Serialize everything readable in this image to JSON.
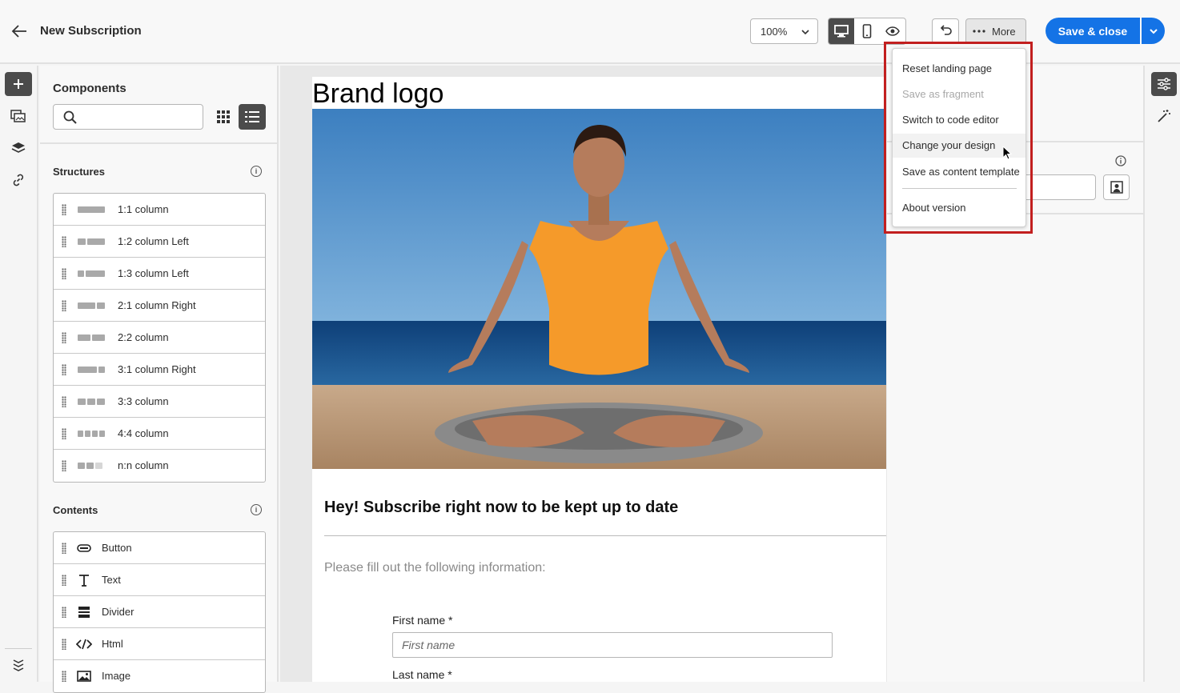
{
  "header": {
    "title": "New Subscription",
    "zoom_value": "100%",
    "more_label": "More",
    "save_label": "Save & close"
  },
  "components_panel": {
    "title": "Components",
    "search_placeholder": "",
    "structures_title": "Structures",
    "structures": [
      {
        "label": "1:1 column",
        "icon": "one-one-column"
      },
      {
        "label": "1:2 column Left",
        "icon": "one-two-column-left"
      },
      {
        "label": "1:3 column Left",
        "icon": "one-three-column-left"
      },
      {
        "label": "2:1 column Right",
        "icon": "two-one-column-right"
      },
      {
        "label": "2:2 column",
        "icon": "two-two-column"
      },
      {
        "label": "3:1 column Right",
        "icon": "three-one-column-right"
      },
      {
        "label": "3:3 column",
        "icon": "three-three-column"
      },
      {
        "label": "4:4 column",
        "icon": "four-four-column"
      },
      {
        "label": "n:n column",
        "icon": "n-n-column"
      }
    ],
    "contents_title": "Contents",
    "contents": [
      {
        "label": "Button",
        "icon": "button-icon"
      },
      {
        "label": "Text",
        "icon": "text-icon"
      },
      {
        "label": "Divider",
        "icon": "divider-icon"
      },
      {
        "label": "Html",
        "icon": "code-icon"
      },
      {
        "label": "Image",
        "icon": "image-icon"
      }
    ]
  },
  "canvas": {
    "brand_logo": "Brand logo",
    "headline": "Hey! Subscribe right now to be kept up to date",
    "subtext": "Please fill out the following information:",
    "first_name_label": "First name",
    "first_name_placeholder": "First name",
    "last_name_label": "Last name",
    "required_marker": "*"
  },
  "more_menu": {
    "items": [
      {
        "label": "Reset landing page",
        "disabled": false
      },
      {
        "label": "Save as fragment",
        "disabled": true
      },
      {
        "label": "Switch to code editor",
        "disabled": false
      },
      {
        "label": "Change your design",
        "disabled": false,
        "hovered": true
      },
      {
        "label": "Save as content template",
        "disabled": false
      },
      {
        "label": "About version",
        "disabled": false
      }
    ]
  },
  "colors": {
    "accent": "#1473e6",
    "highlight_border": "#c21f1f",
    "active_toggle": "#4b4b4b"
  }
}
